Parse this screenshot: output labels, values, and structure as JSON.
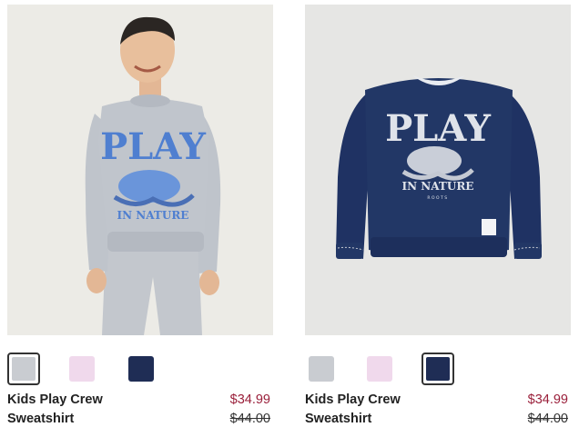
{
  "products": [
    {
      "name_line1": "Kids Play Crew",
      "name_line2": "Sweatshirt",
      "price": "$34.99",
      "original_price": "$44.00",
      "image_text": {
        "headline": "PLAY",
        "sub": "IN NATURE",
        "brand": ""
      },
      "swatches": [
        {
          "color": "#c9ccd1",
          "label": "grey",
          "selected": true
        },
        {
          "color": "#f0d9ec",
          "label": "pink",
          "selected": false
        },
        {
          "color": "#1f2d55",
          "label": "navy",
          "selected": false
        }
      ]
    },
    {
      "name_line1": "Kids Play Crew",
      "name_line2": "Sweatshirt",
      "price": "$34.99",
      "original_price": "$44.00",
      "image_text": {
        "headline": "PLAY",
        "sub": "IN NATURE",
        "brand": "ROOTS"
      },
      "swatches": [
        {
          "color": "#c9ccd1",
          "label": "grey",
          "selected": false
        },
        {
          "color": "#f0d9ec",
          "label": "pink",
          "selected": false
        },
        {
          "color": "#1f2d55",
          "label": "navy",
          "selected": true
        }
      ]
    }
  ],
  "colors": {
    "sale_price": "#9a1f3a",
    "photo_bg_left": "#ecebe6",
    "photo_bg_right": "#e6e6e4",
    "sweatshirt_grey": "#b9bec6",
    "sweatshirt_navy": "#1f3263",
    "print_blue": "#4f7fd0",
    "print_light": "#dfe3ea"
  }
}
